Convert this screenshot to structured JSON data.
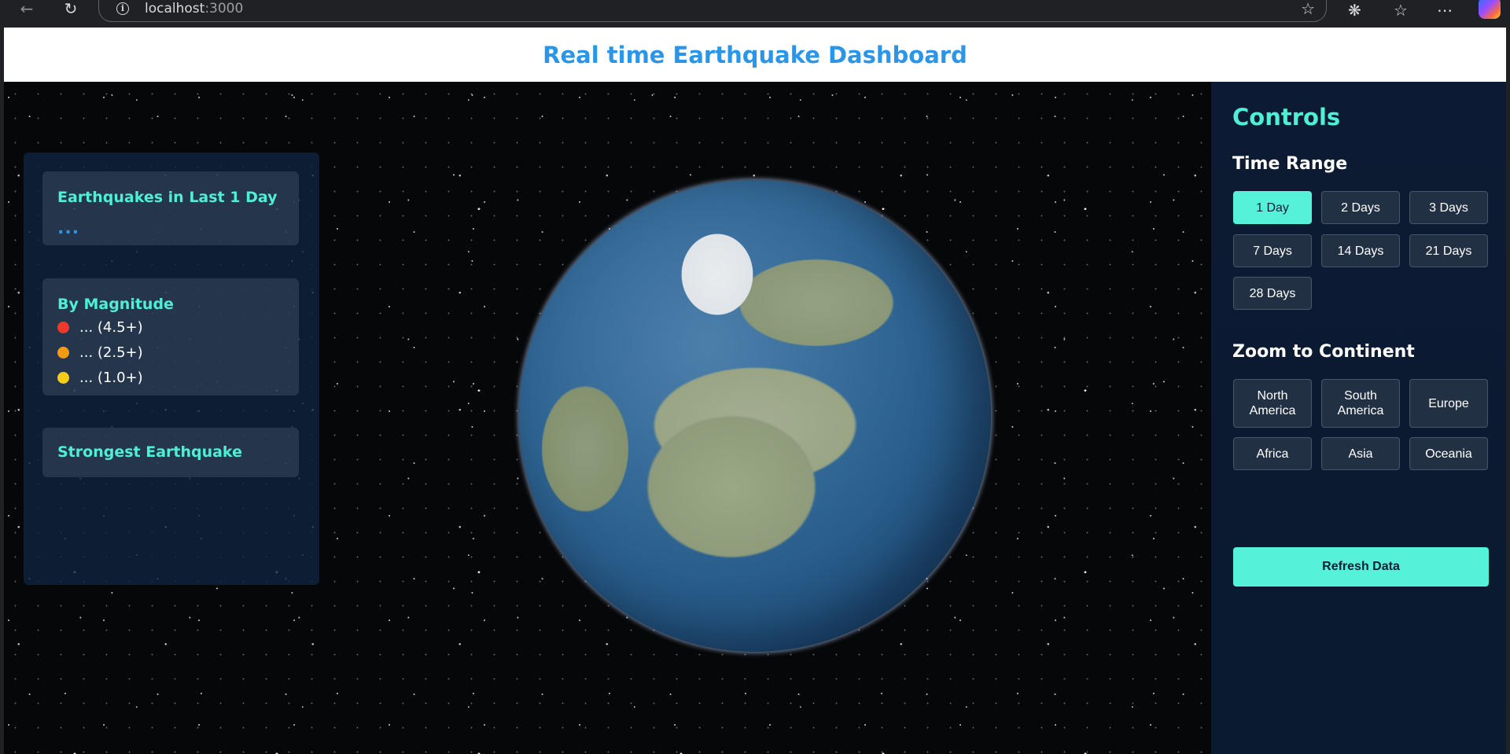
{
  "browser": {
    "url_host": "localhost",
    "url_port": ":3000"
  },
  "header": {
    "title": "Real time Earthquake Dashboard"
  },
  "stats": {
    "count_card": {
      "title": "Earthquakes in Last 1 Day",
      "value": "..."
    },
    "magnitude_card": {
      "title": "By Magnitude",
      "items": [
        {
          "label": "... (4.5+)",
          "color": "#f0392b"
        },
        {
          "label": "... (2.5+)",
          "color": "#f59a11"
        },
        {
          "label": "... (1.0+)",
          "color": "#f5cc16"
        }
      ]
    },
    "strongest_card": {
      "title": "Strongest Earthquake"
    }
  },
  "controls": {
    "title": "Controls",
    "time_range": {
      "heading": "Time Range",
      "options": [
        "1 Day",
        "2 Days",
        "3 Days",
        "7 Days",
        "14 Days",
        "21 Days",
        "28 Days"
      ],
      "selected": "1 Day"
    },
    "continents": {
      "heading": "Zoom to Continent",
      "options": [
        "North America",
        "South America",
        "Europe",
        "Africa",
        "Asia",
        "Oceania"
      ]
    },
    "refresh_label": "Refresh Data"
  },
  "colors": {
    "accent": "#55f2d8",
    "title_blue": "#2b95e8"
  }
}
